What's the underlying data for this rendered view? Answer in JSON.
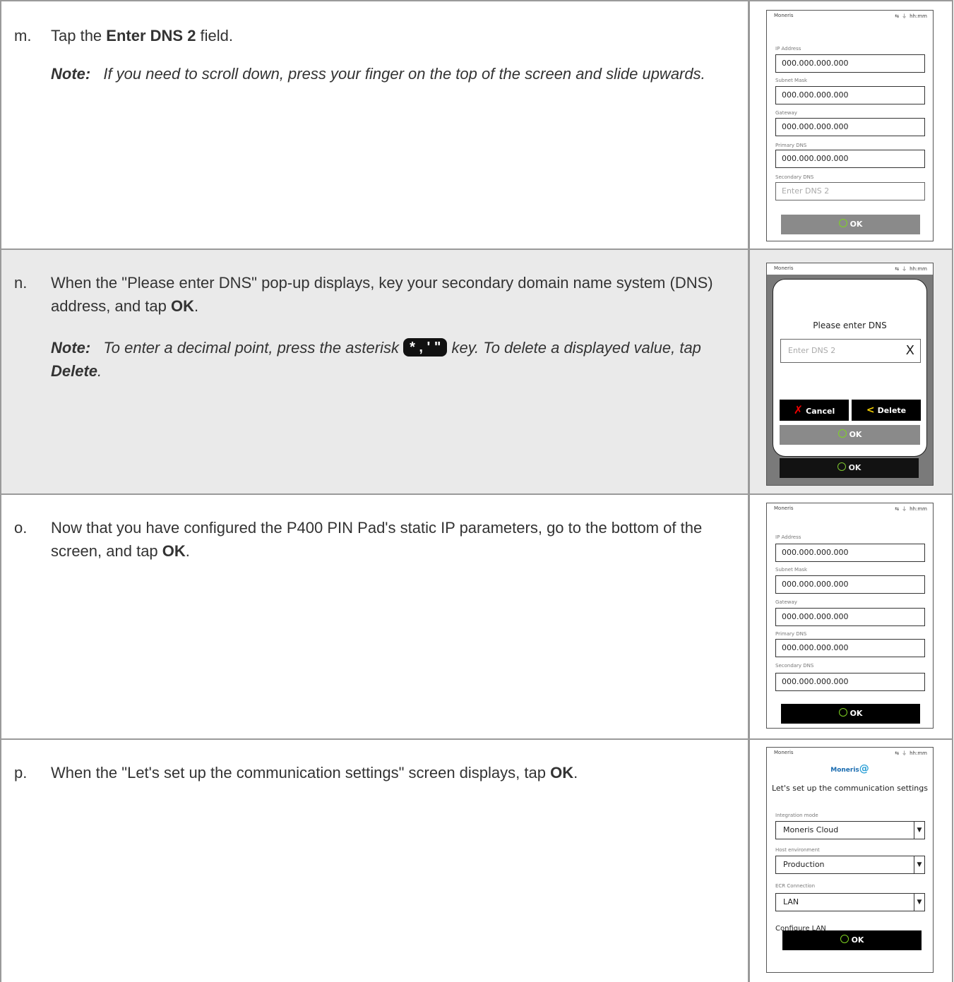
{
  "steps": {
    "m": {
      "letter": "m.",
      "text_pre": "Tap the ",
      "text_bold": "Enter DNS 2",
      "text_post": " field.",
      "note_label": "Note:",
      "note_text": "If you need to scroll down, press your finger on the top of the screen and slide upwards."
    },
    "n": {
      "letter": "n.",
      "text_pre": "When the \"Please enter DNS\" pop-up displays, key your secondary domain name system (DNS) address, and tap ",
      "text_bold": "OK",
      "text_post": ".",
      "note_label": "Note:",
      "note_pre": "To enter a decimal point, press the asterisk ",
      "note_key": "* , ' \"",
      "note_mid": " key.  To delete a displayed value, tap ",
      "note_bold": "Delete",
      "note_post": "."
    },
    "o": {
      "letter": "o.",
      "text_pre": "Now that you have configured the P400 PIN Pad's static IP parameters, go to the bottom of the screen, and tap ",
      "text_bold": "OK",
      "text_post": "."
    },
    "p": {
      "letter": "p.",
      "text_pre": "When the \"Let's set up the communication settings\" screen displays, tap ",
      "text_bold": "OK",
      "text_post": "."
    }
  },
  "device": {
    "brand": "Moneris",
    "time": "hh:mm",
    "labels": {
      "ip": "IP Address",
      "subnet": "Subnet Mask",
      "gateway": "Gateway",
      "primary_dns": "Primary DNS",
      "secondary_dns": "Secondary DNS"
    },
    "ip_value": "000.000.000.000",
    "dns2_placeholder": "Enter DNS 2",
    "ok_label": "OK",
    "popup": {
      "title": "Please enter DNS",
      "placeholder": "Enter DNS 2",
      "clear": "X",
      "cancel": "Cancel",
      "delete": "Delete"
    },
    "comm": {
      "logo": "Moneris",
      "heading": "Let's set up the communication settings",
      "integration_label": "Integration mode",
      "integration_value": "Moneris Cloud",
      "host_label": "Host environment",
      "host_value": "Production",
      "ecr_label": "ECR Connection",
      "ecr_value": "LAN",
      "configure_label": "Configure LAN"
    }
  }
}
